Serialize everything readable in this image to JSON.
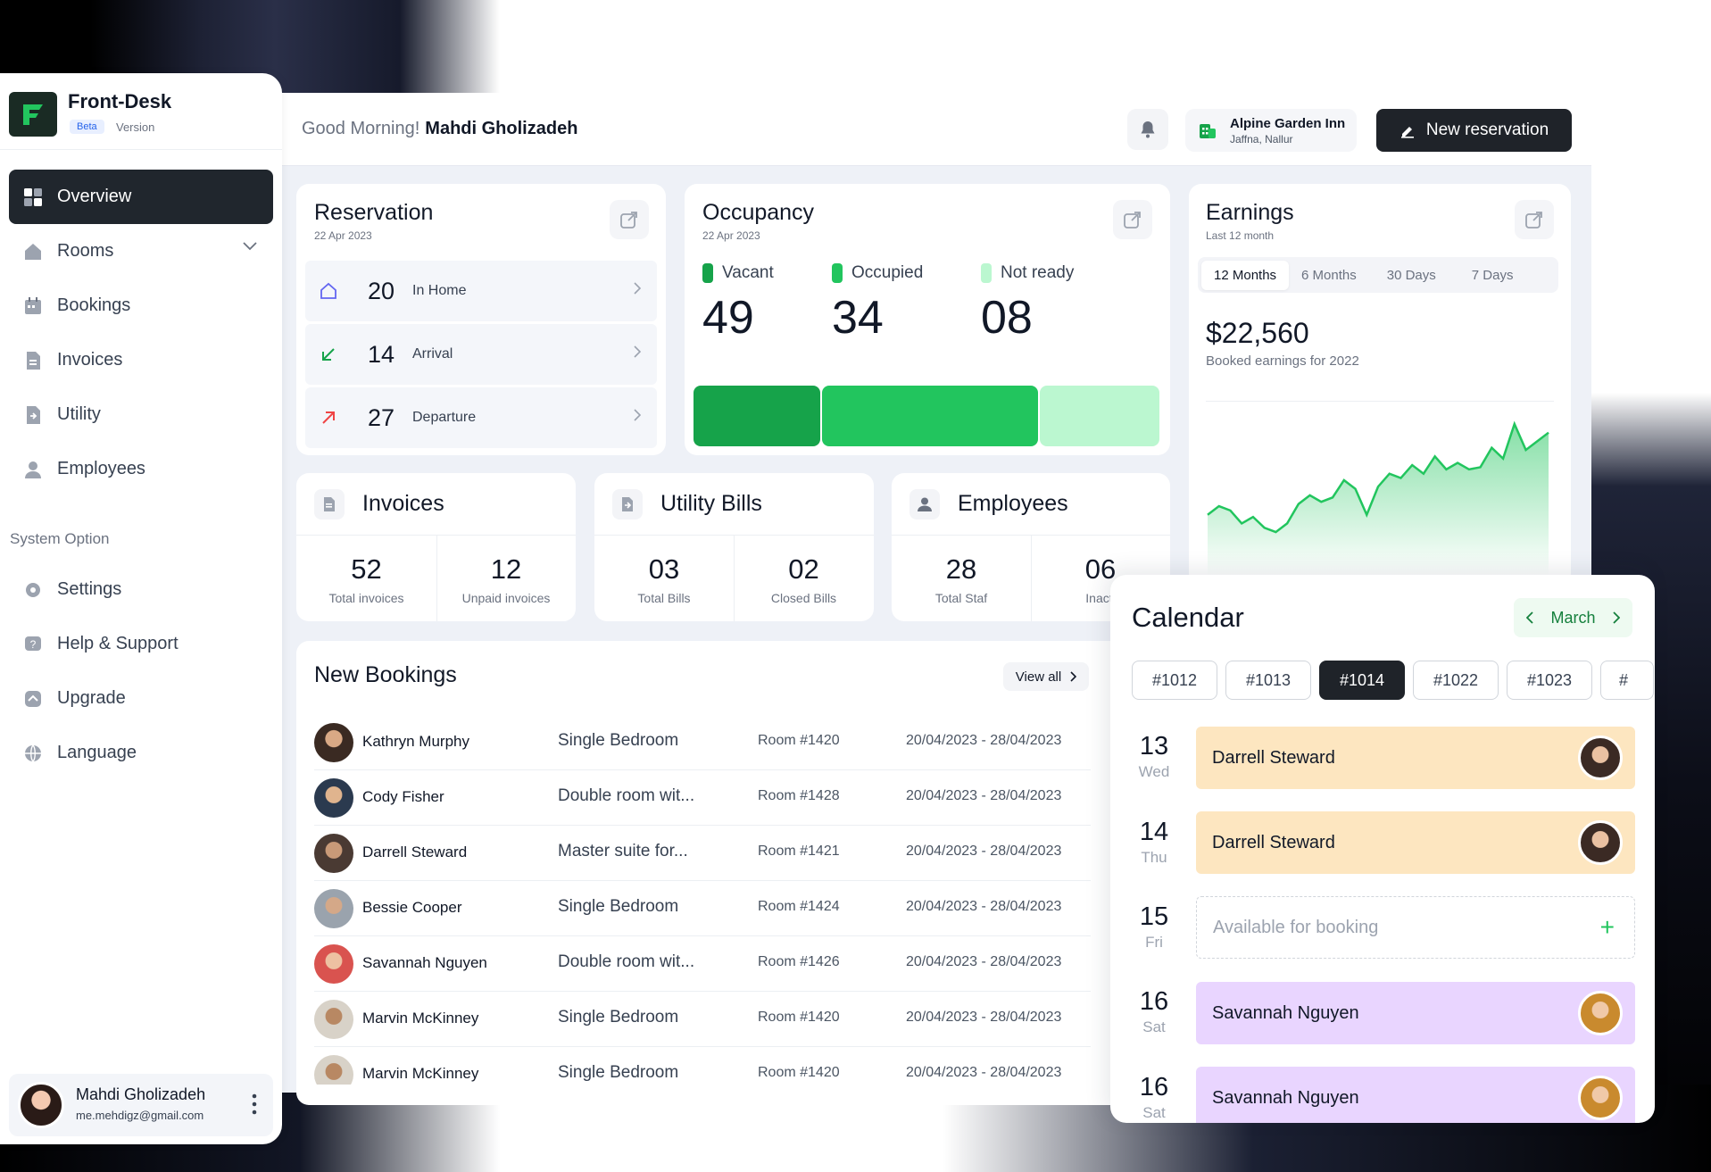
{
  "app": {
    "name": "Front-Desk",
    "badge": "Beta",
    "version_label": "Version"
  },
  "header": {
    "greeting": "Good Morning!",
    "user_name": "Mahdi Gholizadeh",
    "hotel_name": "Alpine Garden Inn",
    "hotel_location": "Jaffna, Nallur",
    "new_reservation_label": "New reservation"
  },
  "sidebar": {
    "items": [
      {
        "label": "Overview",
        "icon": "grid-icon",
        "active": true
      },
      {
        "label": "Rooms",
        "icon": "home-icon",
        "has_chevron": true
      },
      {
        "label": "Bookings",
        "icon": "calendar-icon"
      },
      {
        "label": "Invoices",
        "icon": "document-icon"
      },
      {
        "label": "Utility",
        "icon": "utility-icon"
      },
      {
        "label": "Employees",
        "icon": "user-icon"
      }
    ],
    "system_title": "System Option",
    "system_items": [
      {
        "label": "Settings",
        "icon": "gear-icon"
      },
      {
        "label": "Help & Support",
        "icon": "help-icon"
      },
      {
        "label": "Upgrade",
        "icon": "upgrade-icon"
      },
      {
        "label": "Language",
        "icon": "globe-icon"
      }
    ],
    "user": {
      "name": "Mahdi Gholizadeh",
      "email": "me.mehdigz@gmail.com"
    }
  },
  "reservation": {
    "title": "Reservation",
    "date": "22 Apr 2023",
    "rows": [
      {
        "value": "20",
        "label": "In Home",
        "icon": "home-icon",
        "color": "#6366f1"
      },
      {
        "value": "14",
        "label": "Arrival",
        "icon": "arrow-down-left-icon",
        "color": "#16a34a"
      },
      {
        "value": "27",
        "label": "Departure",
        "icon": "arrow-up-right-icon",
        "color": "#ef4444"
      }
    ]
  },
  "occupancy": {
    "title": "Occupancy",
    "date": "22 Apr 2023",
    "items": [
      {
        "label": "Vacant",
        "value": "49",
        "color": "#16a34a"
      },
      {
        "label": "Occupied",
        "value": "34",
        "color": "#22c55e"
      },
      {
        "label": "Not ready",
        "value": "08",
        "color": "#bbf7d0"
      }
    ]
  },
  "earnings": {
    "title": "Earnings",
    "subtitle": "Last 12 month",
    "tabs": [
      "12 Months",
      "6 Months",
      "30 Days",
      "7 Days"
    ],
    "active_tab": "12 Months",
    "amount": "$22,560",
    "caption": "Booked earnings for 2022",
    "series": [
      22,
      26,
      24,
      18,
      21,
      16,
      14,
      18,
      27,
      31,
      28,
      30,
      38,
      34,
      22,
      35,
      41,
      39,
      45,
      41,
      49,
      43,
      46,
      43,
      44,
      53,
      48,
      64,
      52,
      56,
      60
    ]
  },
  "invoices": {
    "title": "Invoices",
    "stats": [
      {
        "value": "52",
        "label": "Total invoices"
      },
      {
        "value": "12",
        "label": "Unpaid invoices"
      }
    ]
  },
  "utility": {
    "title": "Utility Bills",
    "stats": [
      {
        "value": "03",
        "label": "Total Bills"
      },
      {
        "value": "02",
        "label": "Closed Bills"
      }
    ]
  },
  "employees": {
    "title": "Employees",
    "stats": [
      {
        "value": "28",
        "label": "Total Staf"
      },
      {
        "value": "06",
        "label": "Inacti"
      }
    ]
  },
  "bookings": {
    "title": "New Bookings",
    "view_all": "View all",
    "rows": [
      {
        "name": "Kathryn Murphy",
        "room_type": "Single Bedroom",
        "room": "Room #1420",
        "dates": "20/04/2023 - 28/04/2023"
      },
      {
        "name": "Cody Fisher",
        "room_type": "Double room wit...",
        "room": "Room #1428",
        "dates": "20/04/2023 - 28/04/2023"
      },
      {
        "name": "Darrell Steward",
        "room_type": "Master suite for...",
        "room": "Room #1421",
        "dates": "20/04/2023 - 28/04/2023"
      },
      {
        "name": "Bessie Cooper",
        "room_type": "Single Bedroom",
        "room": "Room #1424",
        "dates": "20/04/2023 - 28/04/2023"
      },
      {
        "name": "Savannah Nguyen",
        "room_type": "Double room wit...",
        "room": "Room #1426",
        "dates": "20/04/2023 - 28/04/2023"
      },
      {
        "name": "Marvin McKinney",
        "room_type": "Single Bedroom",
        "room": "Room #1420",
        "dates": "20/04/2023 - 28/04/2023"
      },
      {
        "name": "Marvin McKinney",
        "room_type": "Single Bedroom",
        "room": "Room #1420",
        "dates": "20/04/2023 - 28/04/2023"
      }
    ]
  },
  "calendar": {
    "title": "Calendar",
    "month": "March",
    "rooms": [
      "#1012",
      "#1013",
      "#1014",
      "#1022",
      "#1023",
      "#"
    ],
    "active_room": "#1014",
    "days": [
      {
        "day": "13",
        "weekday": "Wed",
        "guest": "Darrell Steward",
        "color": "#fde6c0"
      },
      {
        "day": "14",
        "weekday": "Thu",
        "guest": "Darrell Steward",
        "color": "#fde6c0"
      },
      {
        "day": "15",
        "weekday": "Fri",
        "guest": "Available for booking",
        "empty": true
      },
      {
        "day": "16",
        "weekday": "Sat",
        "guest": "Savannah Nguyen",
        "color": "#e9d5ff"
      },
      {
        "day": "16",
        "weekday": "Sat",
        "guest": "Savannah Nguyen",
        "color": "#e9d5ff"
      }
    ]
  }
}
